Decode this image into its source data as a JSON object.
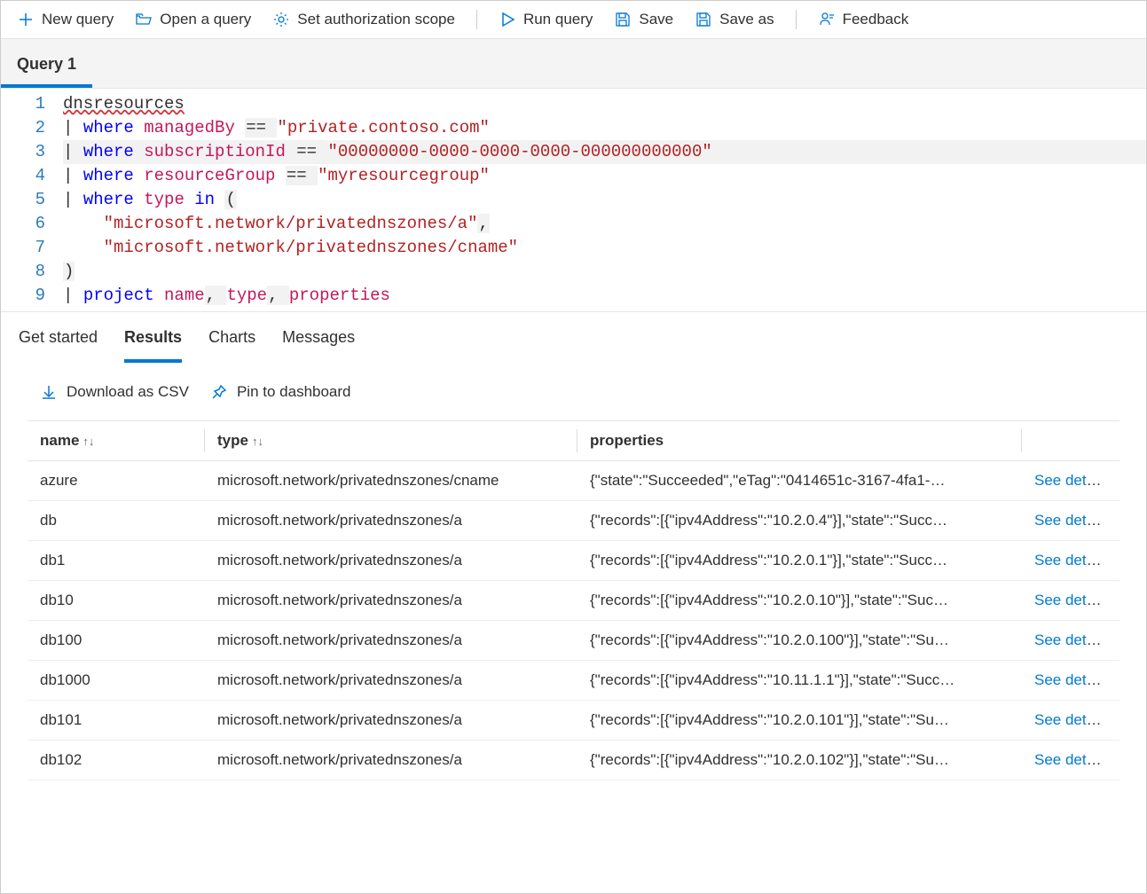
{
  "toolbar": {
    "new_query": "New query",
    "open_query": "Open a query",
    "set_auth": "Set authorization scope",
    "run_query": "Run query",
    "save": "Save",
    "save_as": "Save as",
    "feedback": "Feedback"
  },
  "query_tab": {
    "label": "Query 1"
  },
  "editor": {
    "lines": [
      {
        "num": "1",
        "tokens": [
          {
            "t": "dnsresources",
            "c": "squiggly"
          }
        ]
      },
      {
        "num": "2",
        "tokens": [
          {
            "t": "| ",
            "c": "pipe"
          },
          {
            "t": "where ",
            "c": "kw"
          },
          {
            "t": "managedBy ",
            "c": "fn"
          },
          {
            "t": "== ",
            "c": "op"
          },
          {
            "t": "\"private.contoso.com\"",
            "c": "str"
          }
        ]
      },
      {
        "num": "3",
        "tokens": [
          {
            "t": "| ",
            "c": "pipe"
          },
          {
            "t": "where ",
            "c": "kw"
          },
          {
            "t": "subscriptionId ",
            "c": "fn"
          },
          {
            "t": "== ",
            "c": "op"
          },
          {
            "t": "\"00000000-0000-0000-0000-000000000000\"",
            "c": "str"
          }
        ],
        "hl": true
      },
      {
        "num": "4",
        "tokens": [
          {
            "t": "| ",
            "c": "pipe"
          },
          {
            "t": "where ",
            "c": "kw"
          },
          {
            "t": "resourceGroup ",
            "c": "fn"
          },
          {
            "t": "== ",
            "c": "op"
          },
          {
            "t": "\"myresourcegroup\"",
            "c": "str"
          }
        ]
      },
      {
        "num": "5",
        "tokens": [
          {
            "t": "| ",
            "c": "pipe"
          },
          {
            "t": "where ",
            "c": "kw"
          },
          {
            "t": "type ",
            "c": "fn"
          },
          {
            "t": "in ",
            "c": "kw"
          },
          {
            "t": "(",
            "c": "op"
          }
        ]
      },
      {
        "num": "6",
        "tokens": [
          {
            "t": "    ",
            "c": ""
          },
          {
            "t": "\"microsoft.network/privatednszones/a\"",
            "c": "str"
          },
          {
            "t": ",",
            "c": "op"
          }
        ]
      },
      {
        "num": "7",
        "tokens": [
          {
            "t": "    ",
            "c": ""
          },
          {
            "t": "\"microsoft.network/privatednszones/cname\"",
            "c": "str"
          }
        ]
      },
      {
        "num": "8",
        "tokens": [
          {
            "t": ")",
            "c": "op"
          }
        ]
      },
      {
        "num": "9",
        "tokens": [
          {
            "t": "| ",
            "c": "pipe"
          },
          {
            "t": "project ",
            "c": "kw"
          },
          {
            "t": "name",
            "c": "fn"
          },
          {
            "t": ", ",
            "c": "op"
          },
          {
            "t": "type",
            "c": "fn"
          },
          {
            "t": ", ",
            "c": "op"
          },
          {
            "t": "properties",
            "c": "fn"
          }
        ]
      }
    ]
  },
  "results_tabs": {
    "get_started": "Get started",
    "results": "Results",
    "charts": "Charts",
    "messages": "Messages"
  },
  "results_actions": {
    "download_csv": "Download as CSV",
    "pin_dashboard": "Pin to dashboard"
  },
  "table": {
    "columns": {
      "name": "name",
      "type": "type",
      "properties": "properties"
    },
    "see_details": "See details",
    "rows": [
      {
        "name": "azure",
        "type": "microsoft.network/privatednszones/cname",
        "properties": "{\"state\":\"Succeeded\",\"eTag\":\"0414651c-3167-4fa1-…"
      },
      {
        "name": "db",
        "type": "microsoft.network/privatednszones/a",
        "properties": "{\"records\":[{\"ipv4Address\":\"10.2.0.4\"}],\"state\":\"Succ…"
      },
      {
        "name": "db1",
        "type": "microsoft.network/privatednszones/a",
        "properties": "{\"records\":[{\"ipv4Address\":\"10.2.0.1\"}],\"state\":\"Succ…"
      },
      {
        "name": "db10",
        "type": "microsoft.network/privatednszones/a",
        "properties": "{\"records\":[{\"ipv4Address\":\"10.2.0.10\"}],\"state\":\"Suc…"
      },
      {
        "name": "db100",
        "type": "microsoft.network/privatednszones/a",
        "properties": "{\"records\":[{\"ipv4Address\":\"10.2.0.100\"}],\"state\":\"Su…"
      },
      {
        "name": "db1000",
        "type": "microsoft.network/privatednszones/a",
        "properties": "{\"records\":[{\"ipv4Address\":\"10.11.1.1\"}],\"state\":\"Succ…"
      },
      {
        "name": "db101",
        "type": "microsoft.network/privatednszones/a",
        "properties": "{\"records\":[{\"ipv4Address\":\"10.2.0.101\"}],\"state\":\"Su…"
      },
      {
        "name": "db102",
        "type": "microsoft.network/privatednszones/a",
        "properties": "{\"records\":[{\"ipv4Address\":\"10.2.0.102\"}],\"state\":\"Su…"
      }
    ]
  }
}
